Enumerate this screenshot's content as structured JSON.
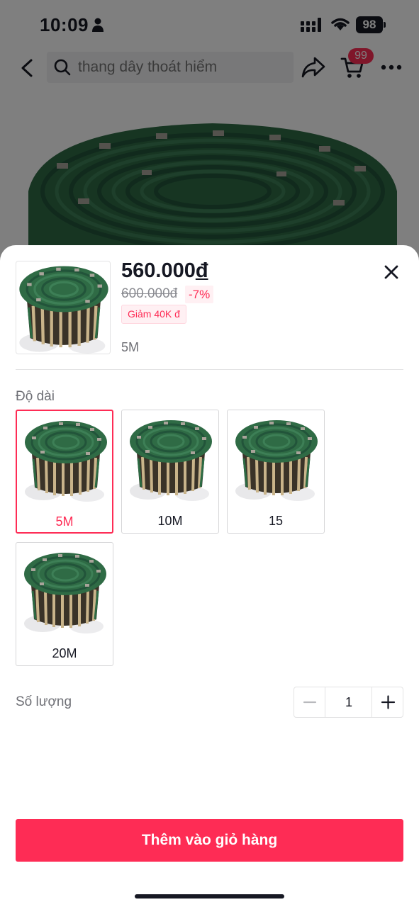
{
  "status_bar": {
    "time": "10:09",
    "battery": "98"
  },
  "nav": {
    "search_placeholder": "thang dây thoát hiểm",
    "cart_badge": "99",
    "icons": [
      "back-icon",
      "search-icon",
      "share-icon",
      "cart-icon",
      "more-icon"
    ]
  },
  "sheet": {
    "price": "560.000",
    "currency_symbol": "đ",
    "original_price": "600.000đ",
    "discount": "-7%",
    "voucher": "Giảm 40K đ",
    "selected_variant": "5M",
    "variant_section_label": "Độ dài",
    "options": [
      {
        "label": "5M",
        "selected": true
      },
      {
        "label": "10M",
        "selected": false
      },
      {
        "label": "15",
        "selected": false
      },
      {
        "label": "20M",
        "selected": false
      }
    ],
    "quantity_label": "Số lượng",
    "quantity": "1",
    "add_to_cart": "Thêm vào giỏ hàng"
  },
  "colors": {
    "accent": "#fe2c55",
    "product_green": "#2f6b45"
  }
}
